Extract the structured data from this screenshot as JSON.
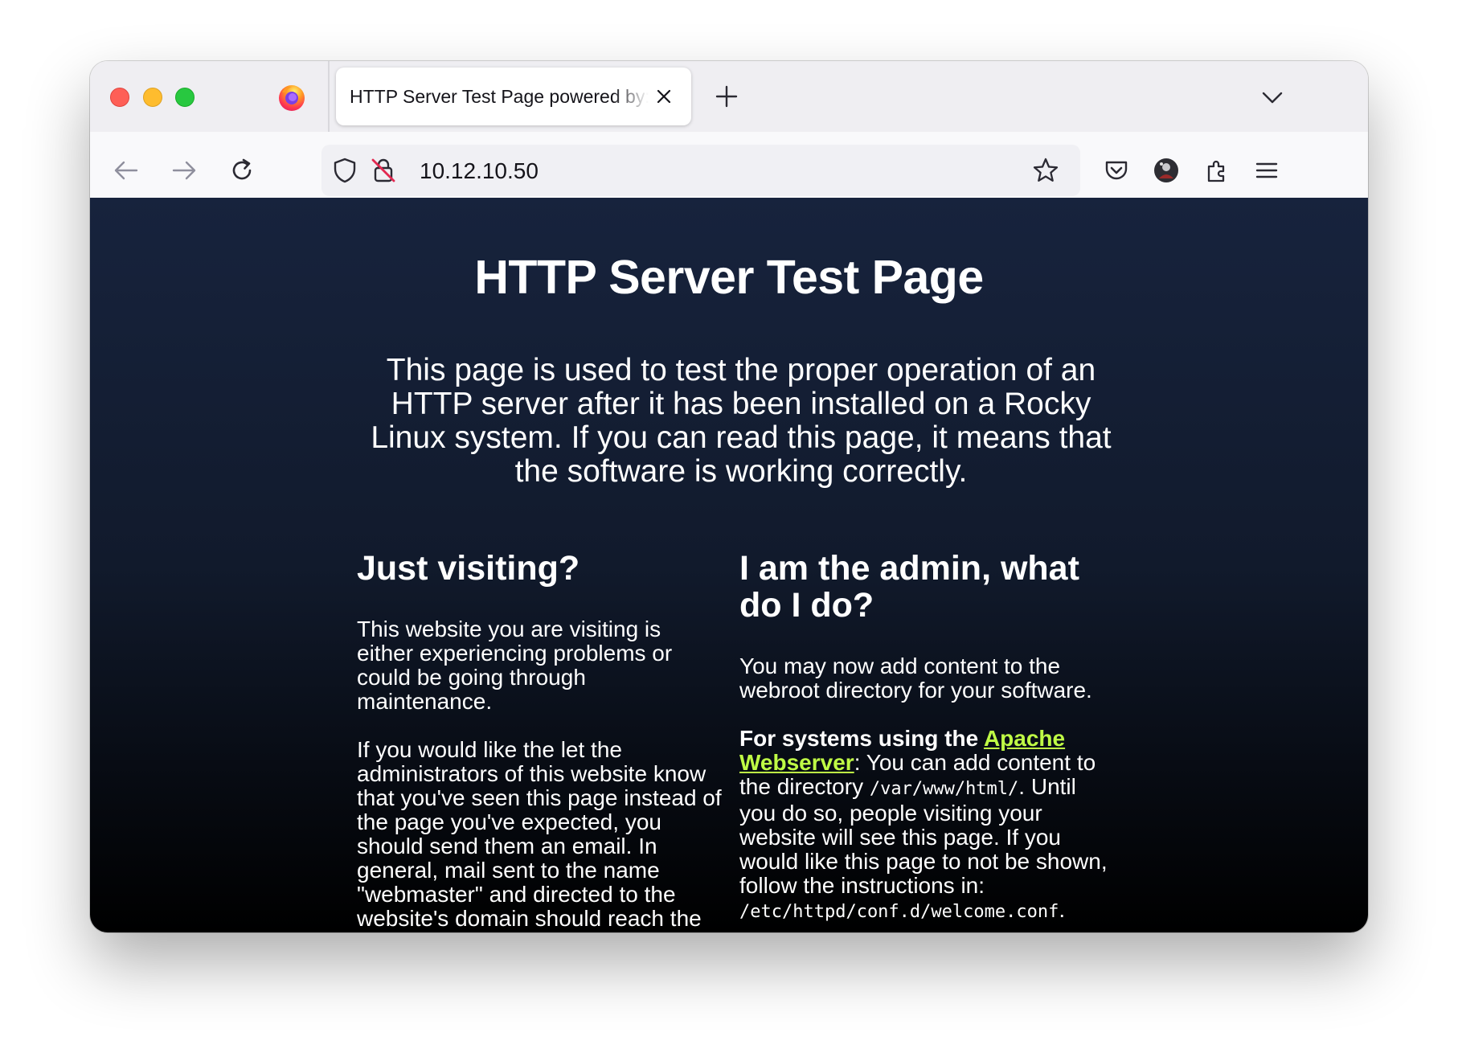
{
  "browser": {
    "tab_title": "HTTP Server Test Page powered by: Rocky Linux",
    "url": "10.12.10.50"
  },
  "page": {
    "title": "HTTP Server Test Page",
    "intro": "This page is used to test the proper operation of an HTTP server after it has been installed on a Rocky Linux system. If you can read this page, it means that the software is working correctly.",
    "left": {
      "heading": "Just visiting?",
      "p1": "This website you are visiting is either experiencing problems or could be going through maintenance.",
      "p2": "If you would like the let the administrators of this website know that you've seen this page instead of the page you've expected, you should send them an email. In general, mail sent to the name \"webmaster\" and directed to the website's domain should reach the"
    },
    "right": {
      "heading": "I am the admin, what do I do?",
      "p1": "You may now add content to the webroot directory for your software.",
      "p2_bold": "For systems using the ",
      "p2_link": "Apache Webserver",
      "p2_text1": ": You can add content to the directory ",
      "p2_code1": "/var/www/html/",
      "p2_text2": ". Until you do so, people visiting your website will see this page. If you would like this page to not be shown, follow the instructions in: ",
      "p2_code2": "/etc/httpd/conf.d/welcome.conf",
      "p2_end": "."
    }
  },
  "colors": {
    "link": "#bffc45",
    "background_top": "#17233d",
    "background_bottom": "#000000"
  }
}
